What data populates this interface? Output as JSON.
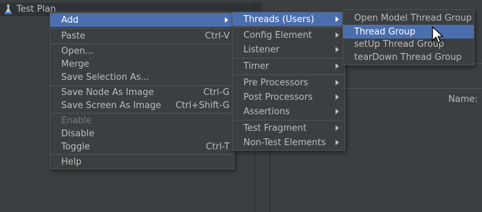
{
  "tree": {
    "root_label": "Test Plan"
  },
  "right_panel": {
    "name_label": "Name:"
  },
  "menu_main": {
    "items": [
      {
        "label": "Add",
        "accel": "",
        "submenu": true,
        "selected": true
      },
      {
        "label": "Paste",
        "accel": "Ctrl-V"
      },
      {
        "label": "Open...",
        "accel": ""
      },
      {
        "label": "Merge",
        "accel": ""
      },
      {
        "label": "Save Selection As...",
        "accel": ""
      },
      {
        "label": "Save Node As Image",
        "accel": "Ctrl-G"
      },
      {
        "label": "Save Screen As Image",
        "accel": "Ctrl+Shift-G"
      },
      {
        "label": "Enable",
        "accel": "",
        "disabled": true
      },
      {
        "label": "Disable",
        "accel": ""
      },
      {
        "label": "Toggle",
        "accel": "Ctrl-T"
      },
      {
        "label": "Help",
        "accel": ""
      }
    ]
  },
  "menu_add": {
    "items": [
      {
        "label": "Threads (Users)",
        "selected": true
      },
      {
        "label": "Config Element"
      },
      {
        "label": "Listener"
      },
      {
        "label": "Timer"
      },
      {
        "label": "Pre Processors"
      },
      {
        "label": "Post Processors"
      },
      {
        "label": "Assertions"
      },
      {
        "label": "Test Fragment"
      },
      {
        "label": "Non-Test Elements"
      }
    ]
  },
  "menu_threads": {
    "items": [
      {
        "label": "Open Model Thread Group"
      },
      {
        "label": "Thread Group",
        "selected": true
      },
      {
        "label": "setUp Thread Group"
      },
      {
        "label": "tearDown Thread Group"
      }
    ]
  },
  "colors": {
    "background": "#3c3f41",
    "selection": "#4b6eaf",
    "text": "#bbbbbb",
    "disabled_text": "#777777"
  }
}
